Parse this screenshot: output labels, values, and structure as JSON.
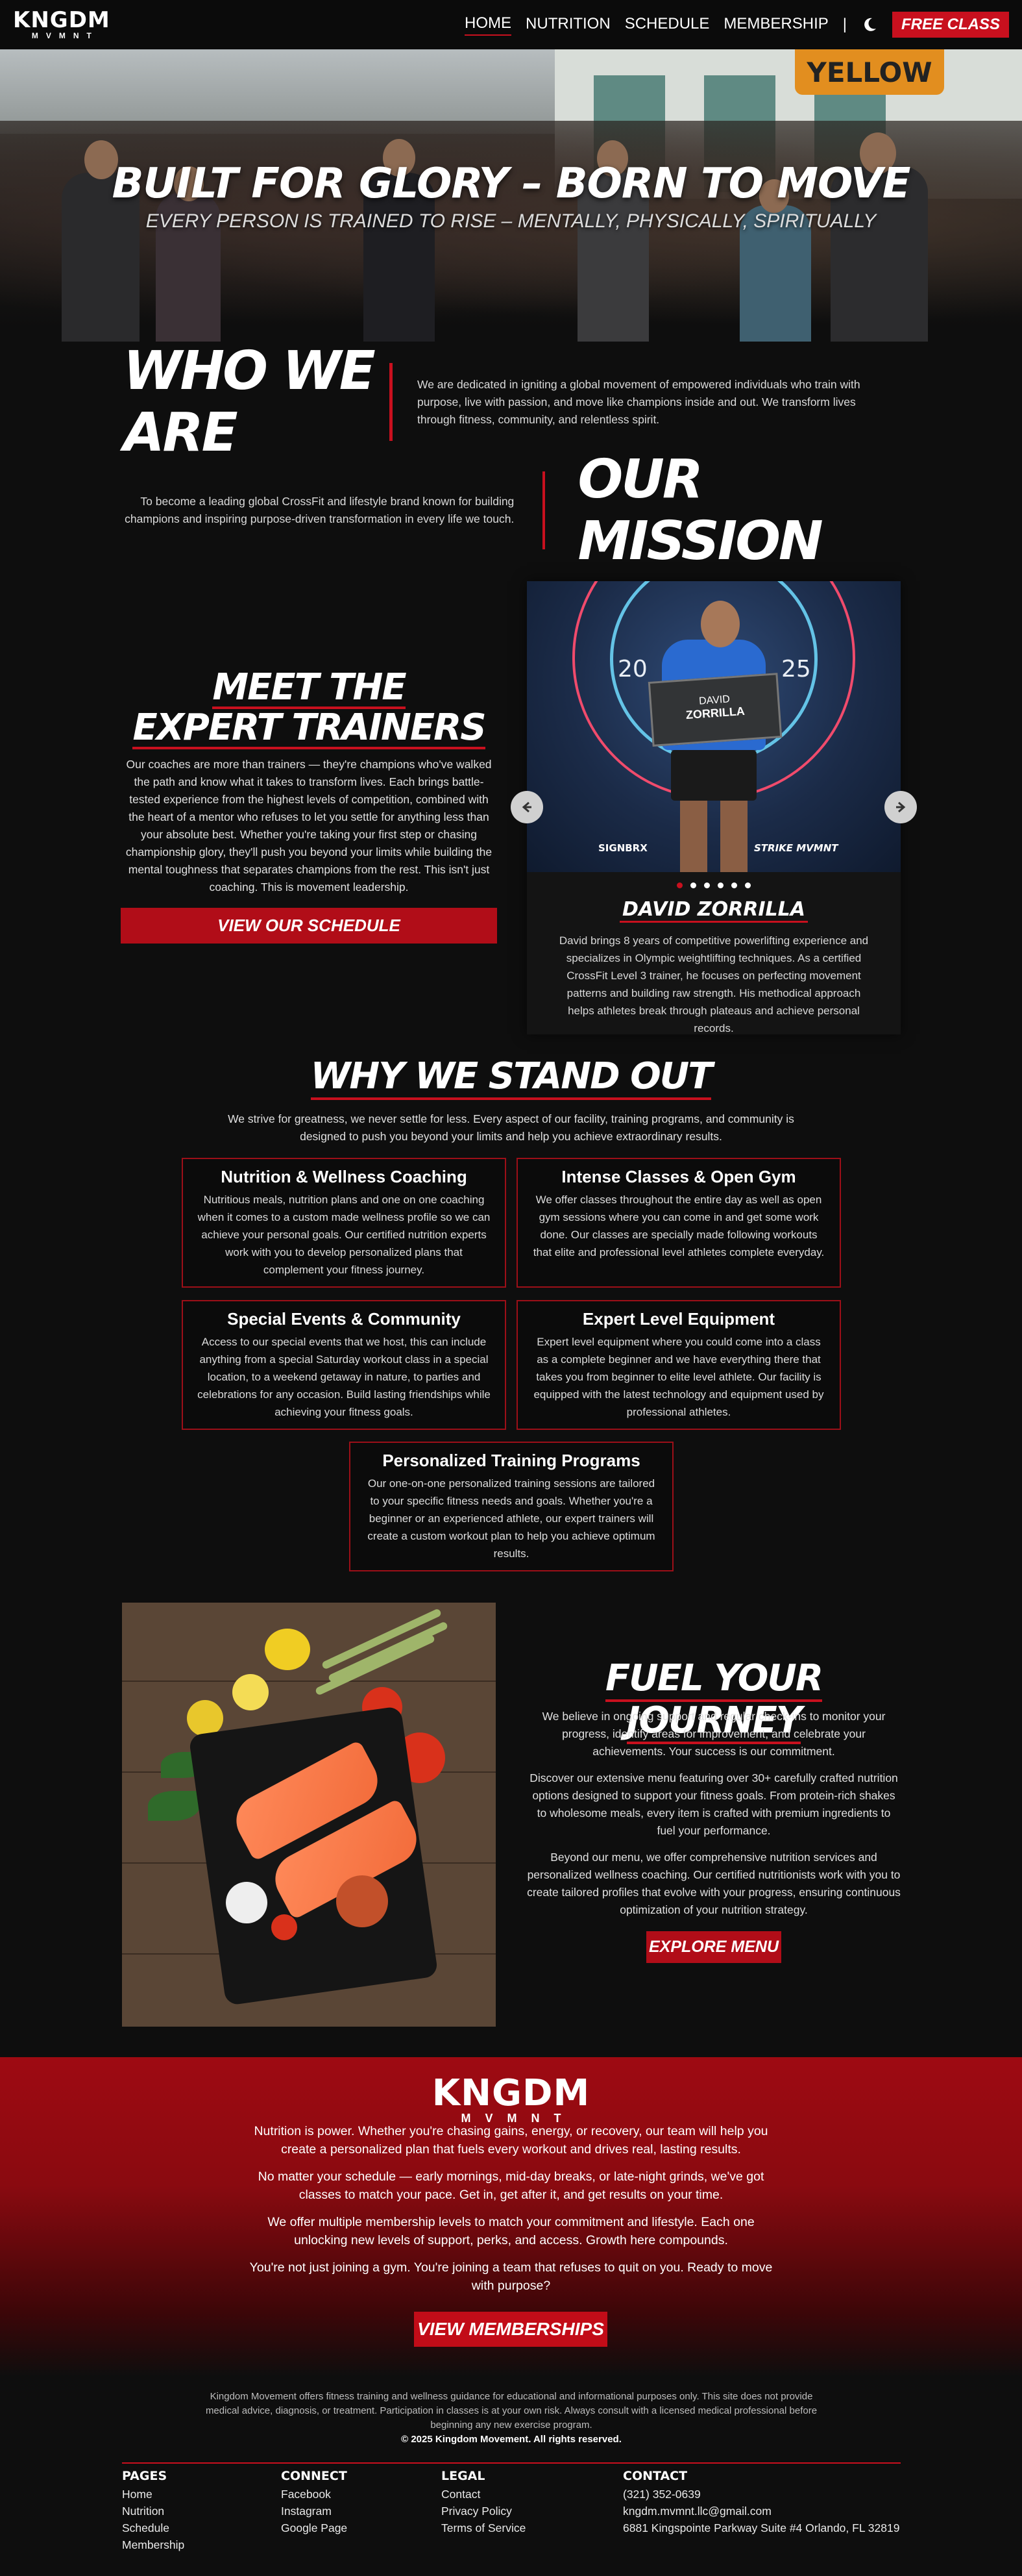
{
  "nav": {
    "logo": "KNGDM",
    "logo_sub": "MVMNT",
    "links": [
      "HOME",
      "NUTRITION",
      "SCHEDULE",
      "MEMBERSHIP"
    ],
    "separator": "|",
    "free_class": "FREE CLASS"
  },
  "hero": {
    "title": "BUILT FOR GLORY – BORN TO MOVE",
    "subtitle": "EVERY PERSON IS TRAINED TO RISE – MENTALLY, PHYSICALLY, SPIRITUALLY",
    "sign": "YELLOW"
  },
  "who": {
    "title": "WHO WE ARE",
    "text": "We are dedicated in igniting a global movement of empowered individuals who train with purpose, live with passion, and move like champions inside and out. We transform lives through fitness, community, and relentless spirit."
  },
  "mission": {
    "title": "OUR MISSION",
    "text": "To become a leading global CrossFit and lifestyle brand known for building champions and inspiring purpose-driven transformation in every life we touch."
  },
  "trainers": {
    "title_line1": "MEET THE",
    "title_line2": "EXPERT TRAINERS",
    "text": "Our coaches are more than trainers — they're champions who've walked the path and know what it takes to transform lives. Each brings battle-tested experience from the highest levels of competition, combined with the heart of a mentor who refuses to let you settle for anything less than your absolute best. Whether you're taking your first step or chasing championship glory, they'll push you beyond your limits while building the mental toughness that separates champions from the rest. This isn't just coaching. This is movement leadership.",
    "button": "VIEW OUR SCHEDULE",
    "slide": {
      "name": "DAVID ZORRILLA",
      "bio": "David brings 8 years of competitive powerlifting experience and specializes in Olympic weightlifting techniques. As a certified CrossFit Level 3 trainer, he focuses on perfecting movement patterns and building raw strength. His methodical approach helps athletes break through plateaus and achieve personal records.",
      "plaque_first": "DAVID",
      "plaque_last": "ZORRILLA",
      "year_left": "20",
      "year_right": "25",
      "sponsor_left": "SIGNBRX",
      "sponsor_right": "STRIKE MVMNT"
    },
    "prev": "◀",
    "next": "▶",
    "slide_count": 6,
    "active_slide": 1
  },
  "why": {
    "title": "WHY WE STAND OUT",
    "intro": "We strive for greatness, we never settle for less. Every aspect of our facility, training programs, and community is designed to push you beyond your limits and help you achieve extraordinary results.",
    "cards": [
      {
        "title": "Nutrition & Wellness Coaching",
        "text": "Nutritious meals, nutrition plans and one on one coaching when it comes to a custom made wellness profile so we can achieve your personal goals. Our certified nutrition experts work with you to develop personalized plans that complement your fitness journey."
      },
      {
        "title": "Intense Classes & Open Gym",
        "text": "We offer classes throughout the entire day as well as open gym sessions where you can come in and get some work done. Our classes are specially made following workouts that elite and professional level athletes complete everyday."
      },
      {
        "title": "Special Events & Community",
        "text": "Access to our special events that we host, this can include anything from a special Saturday workout class in a special location, to a weekend getaway in nature, to parties and celebrations for any occasion. Build lasting friendships while achieving your fitness goals."
      },
      {
        "title": "Expert Level Equipment",
        "text": "Expert level equipment where you could come into a class as a complete beginner and we have everything there that takes you from beginner to elite level athlete. Our facility is equipped with the latest technology and equipment used by professional athletes."
      },
      {
        "title": "Personalized Training Programs",
        "text": "Our one-on-one personalized training sessions are tailored to your specific fitness needs and goals. Whether you're a beginner or an experienced athlete, our expert trainers will create a custom workout plan to help you achieve optimum results."
      }
    ]
  },
  "fuel": {
    "title": "FUEL YOUR JOURNEY",
    "paragraphs": [
      "We believe in ongoing support and regular check-ins to monitor your progress, identify areas for improvement, and celebrate your achievements. Your success is our commitment.",
      "Discover our extensive menu featuring over 30+ carefully crafted nutrition options designed to support your fitness goals. From protein-rich shakes to wholesome meals, every item is crafted with premium ingredients to fuel your performance.",
      "Beyond our menu, we offer comprehensive nutrition services and personalized wellness coaching. Our certified nutritionists work with you to create tailored profiles that evolve with your progress, ensuring continuous optimization of your nutrition strategy."
    ],
    "button": "EXPLORE MENU"
  },
  "cta": {
    "logo": "KNGDM",
    "logo_sub": "MVMNT",
    "paragraphs": [
      "Nutrition is power. Whether you're chasing gains, energy, or recovery, our team will help you create a personalized plan that fuels every workout and drives real, lasting results.",
      "No matter your schedule — early mornings, mid-day breaks, or late-night grinds, we've got classes to match your pace. Get in, get after it, and get results on your time.",
      "We offer multiple membership levels to match your commitment and lifestyle. Each one unlocking new levels of support, perks, and access. Growth here compounds.",
      "You're not just joining a gym. You're joining a team that refuses to quit on you. Ready to move with purpose?"
    ],
    "button": "VIEW MEMBERSHIPS"
  },
  "footer": {
    "disclaimer": "Kingdom Movement offers fitness training and wellness guidance for educational and informational purposes only. This site does not provide medical advice, diagnosis, or treatment. Participation in classes is at your own risk. Always consult with a licensed medical professional before beginning any new exercise program.",
    "copyright": "© 2025 Kingdom Movement. All rights reserved.",
    "columns": [
      {
        "heading": "PAGES",
        "items": [
          "Home",
          "Nutrition",
          "Schedule",
          "Membership"
        ]
      },
      {
        "heading": "CONNECT",
        "items": [
          "Facebook",
          "Instagram",
          "Google Page"
        ]
      },
      {
        "heading": "LEGAL",
        "items": [
          "Contact",
          "Privacy Policy",
          "Terms of Service"
        ]
      },
      {
        "heading": "CONTACT",
        "items": [
          "(321) 352-0639",
          "kngdm.mvmnt.llc@gmail.com",
          "6881 Kingspointe Parkway Suite #4 Orlando, FL 32819"
        ]
      }
    ]
  },
  "colors": {
    "accent": "#c8101e",
    "background": "#0e0e0e",
    "card_border": "#9c0f18"
  }
}
